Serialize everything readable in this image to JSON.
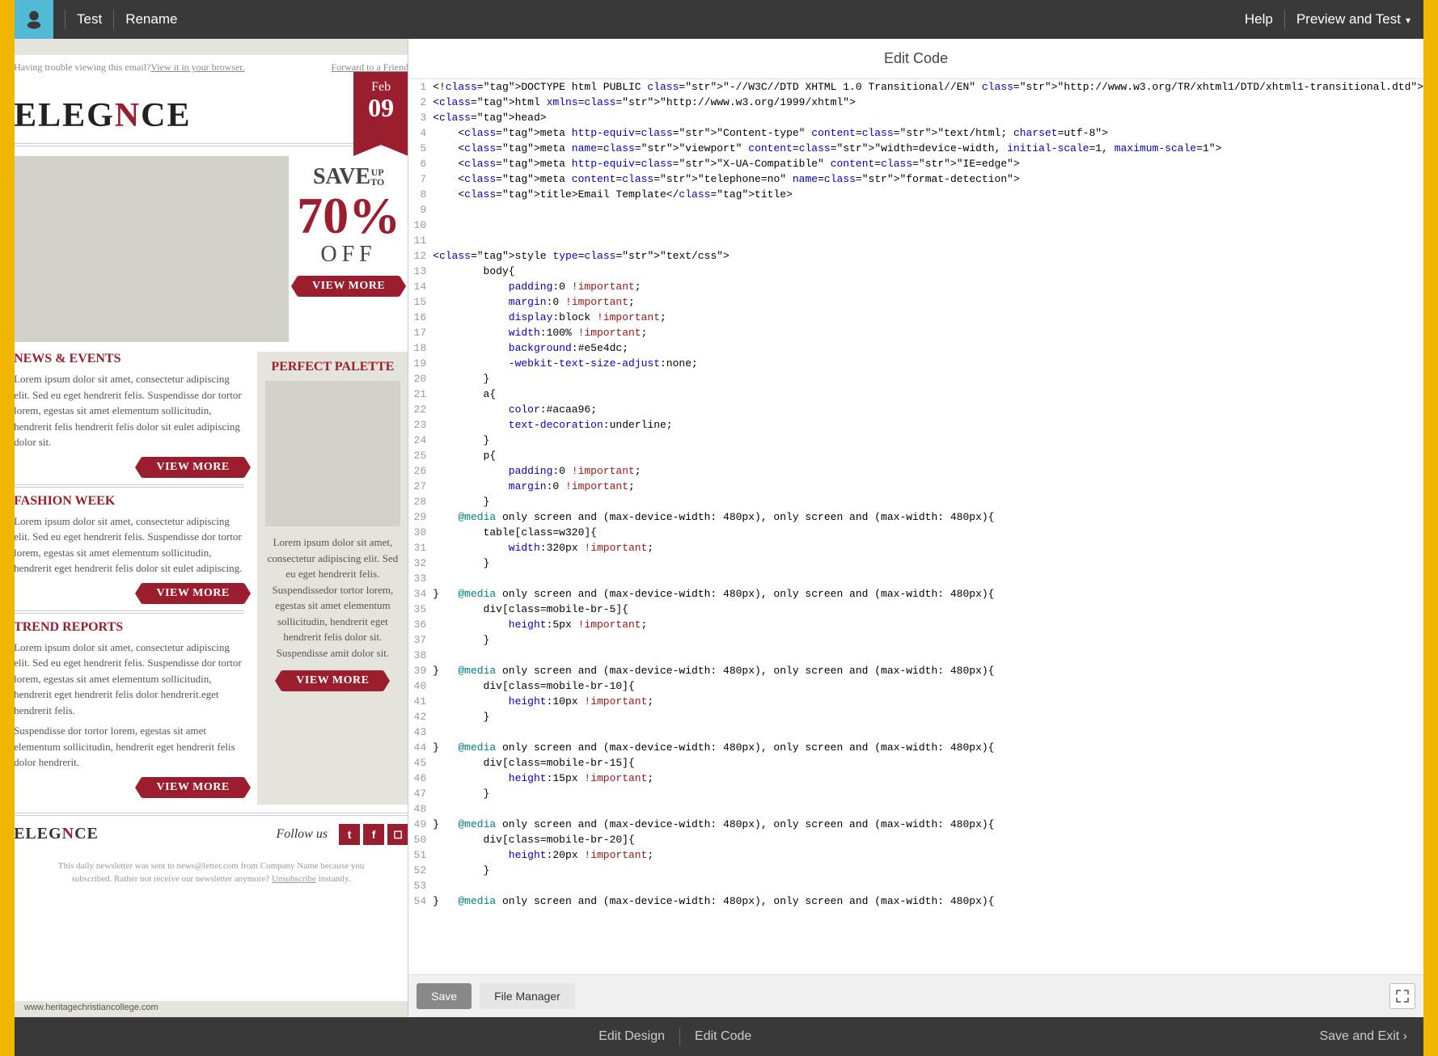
{
  "topbar": {
    "test": "Test",
    "rename": "Rename",
    "help": "Help",
    "preview": "Preview and Test"
  },
  "email": {
    "trouble": "Having trouble viewing this email? ",
    "viewBrowser": "View it in your browser.",
    "forward": "Forward to a Friend",
    "brand1": "ELEG",
    "brandN": "N",
    "brand2": "CE",
    "ribbonMonth": "Feb",
    "ribbonDay": "09",
    "save": "SAVE",
    "up": "UP",
    "to": "TO",
    "pct": "70%",
    "off": "OFF",
    "viewMore": "VIEW MORE",
    "sections": [
      {
        "title": "NEWS & EVENTS",
        "body": "Lorem ipsum dolor sit amet, consectetur adipiscing elit. Sed eu eget hendrerit felis. Suspendisse dor tortor lorem, egestas sit amet elementum sollicitudin, hendrerit felis hendrerit felis dolor sit eulet adipiscing dolor sit."
      },
      {
        "title": "FASHION WEEK",
        "body": "Lorem ipsum dolor sit amet, consectetur adipiscing elit. Sed eu eget hendrerit felis. Suspendisse dor tortor lorem, egestas sit amet elementum sollicitudin, hendrerit eget hendrerit felis dolor sit eulet adipiscing."
      },
      {
        "title": "TREND REPORTS",
        "body": "Lorem ipsum dolor sit amet, consectetur adipiscing elit. Sed eu eget hendrerit felis. Suspendisse dor tortor lorem, egestas sit amet elementum sollicitudin, hendrerit eget hendrerit felis dolor hendrerit.eget hendrerit felis.",
        "body2": "Suspendisse dor tortor lorem, egestas sit amet elementum sollicitudin, hendrerit eget hendrerit felis dolor hendrerit."
      }
    ],
    "sideTitle": "PERFECT PALETTE",
    "sideBody": "Lorem ipsum dolor sit amet, consectetur adipiscing elit. Sed eu eget hendrerit felis. Suspendissedor tortor lorem, egestas sit amet elementum sollicitudin, hendrerit eget hendrerit felis dolor sit. Suspendisse amit dolor sit.",
    "follow": "Follow us",
    "legal1": "This daily newsletter was sent to news@letter.com from Company Name because you subscribed. Rather not receive our newsletter anymore? ",
    "unsub": "Unsubscribe",
    "legal2": " instantly."
  },
  "codePane": {
    "title": "Edit Code",
    "save": "Save",
    "fileManager": "File Manager"
  },
  "code": [
    "<!DOCTYPE html PUBLIC \"-//W3C//DTD XHTML 1.0 Transitional//EN\" \"http://www.w3.org/TR/xhtml1/DTD/xhtml1-transitional.dtd\">",
    "<html xmlns=\"http://www.w3.org/1999/xhtml\">",
    "<head>",
    "    <meta http-equiv=\"Content-type\" content=\"text/html; charset=utf-8\">",
    "    <meta name=\"viewport\" content=\"width=device-width, initial-scale=1, maximum-scale=1\">",
    "    <meta http-equiv=\"X-UA-Compatible\" content=\"IE=edge\">",
    "    <meta content=\"telephone=no\" name=\"format-detection\">",
    "    <title>Email Template</title>",
    "",
    "",
    "",
    "<style type=\"text/css\">",
    "        body{",
    "            padding:0 !important;",
    "            margin:0 !important;",
    "            display:block !important;",
    "            width:100% !important;",
    "            background:#e5e4dc;",
    "            -webkit-text-size-adjust:none;",
    "        }",
    "        a{",
    "            color:#acaa96;",
    "            text-decoration:underline;",
    "        }",
    "        p{",
    "            padding:0 !important;",
    "            margin:0 !important;",
    "        }",
    "    @media only screen and (max-device-width: 480px), only screen and (max-width: 480px){",
    "        table[class=w320]{",
    "            width:320px !important;",
    "        }",
    "",
    "}   @media only screen and (max-device-width: 480px), only screen and (max-width: 480px){",
    "        div[class=mobile-br-5]{",
    "            height:5px !important;",
    "        }",
    "",
    "}   @media only screen and (max-device-width: 480px), only screen and (max-width: 480px){",
    "        div[class=mobile-br-10]{",
    "            height:10px !important;",
    "        }",
    "",
    "}   @media only screen and (max-device-width: 480px), only screen and (max-width: 480px){",
    "        div[class=mobile-br-15]{",
    "            height:15px !important;",
    "        }",
    "",
    "}   @media only screen and (max-device-width: 480px), only screen and (max-width: 480px){",
    "        div[class=mobile-br-20]{",
    "            height:20px !important;",
    "        }",
    "",
    "}   @media only screen and (max-device-width: 480px), only screen and (max-width: 480px){"
  ],
  "bottombar": {
    "editDesign": "Edit Design",
    "editCode": "Edit Code",
    "saveExit": "Save and Exit"
  },
  "watermark": "www.heritagechristiancollege.com"
}
